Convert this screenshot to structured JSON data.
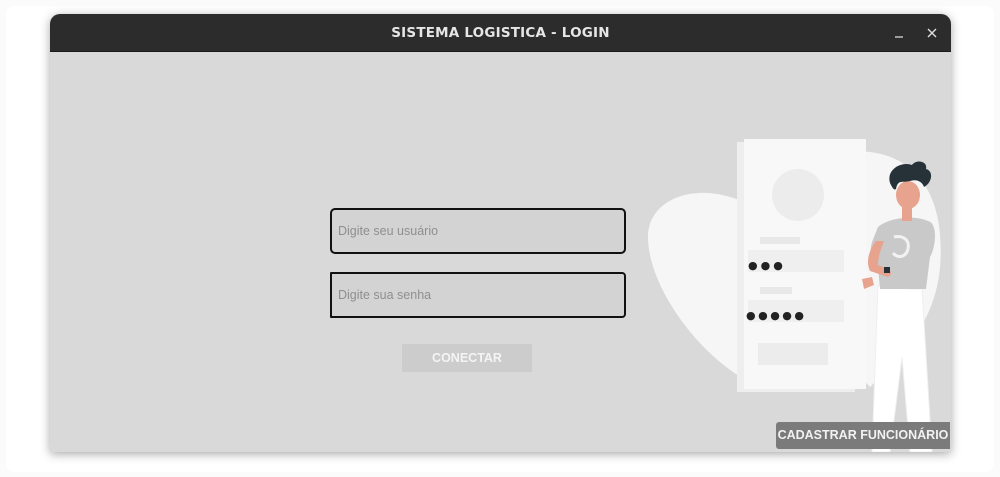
{
  "window": {
    "title": "SISTEMA LOGISTICA - LOGIN",
    "controls": {
      "minimize_icon": "minimize-icon",
      "close_icon": "close-icon"
    }
  },
  "login": {
    "username": {
      "value": "",
      "placeholder": "Digite seu usuário"
    },
    "password": {
      "value": "",
      "placeholder": "Digite sua senha"
    },
    "connect_label": "CONECTAR",
    "register_label": "CADASTRAR FUNCIONÁRIO"
  },
  "illustration": {
    "icon": "person-with-login-form-illustration",
    "pin_dots_top": "●●●",
    "pin_dots_bottom": "●●●●●"
  },
  "colors": {
    "titlebar": "#2c2c2c",
    "window_bg": "#d9d9d9",
    "input_bg": "#d3d3d3",
    "connect_button": "#cccccc",
    "register_button": "#7b7b7b",
    "character_hair": "#263238",
    "character_skin": "#e8a38f"
  }
}
